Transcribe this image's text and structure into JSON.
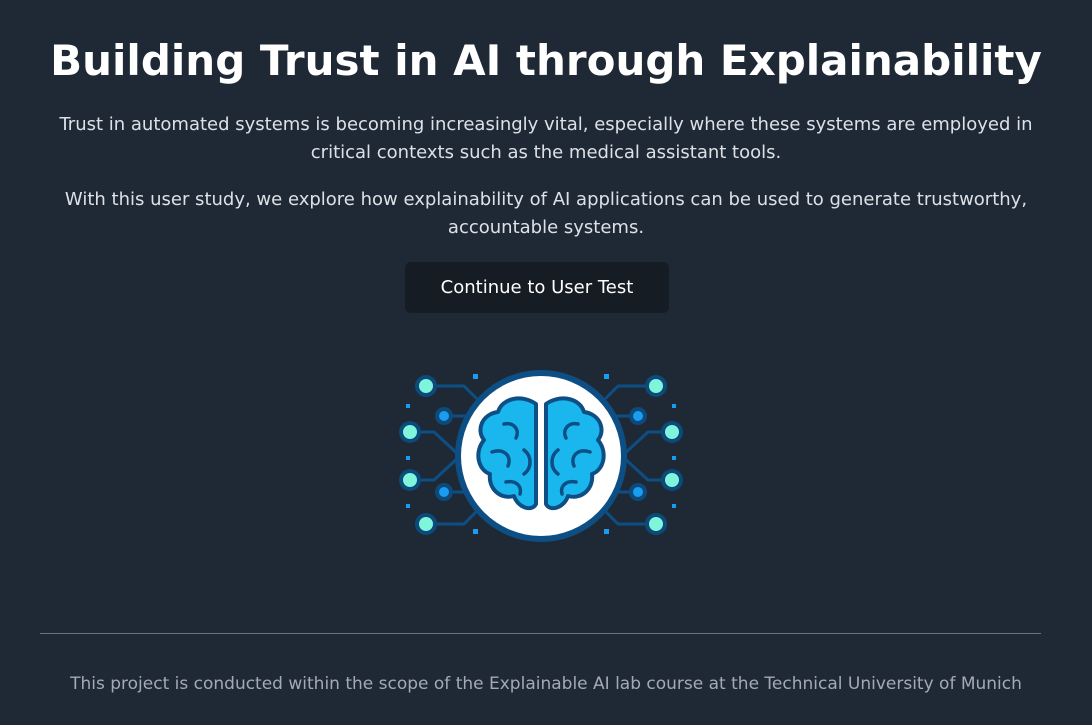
{
  "page": {
    "title": "Building Trust in AI through Explainability",
    "intro_paragraph": "Trust in automated systems is becoming increasingly vital, especially where these systems are employed in critical contexts such as the medical assistant tools.",
    "study_paragraph": "With this user study, we explore how explainability of AI applications can be used to generate trustworthy, accountable systems.",
    "cta_label": "Continue to User Test",
    "illustration_icon": "ai-brain-circuit-icon",
    "footer_text": "This project is conducted within the scope of the Explainable AI lab course at the Technical University of Munich"
  },
  "colors": {
    "background": "#1f2935",
    "button_background": "#151c24",
    "brain_fill": "#1ab6ee",
    "brain_outline": "#0d4f85",
    "node_teal": "#7ff5dc",
    "node_blue": "#1a9cf0",
    "node_ring": "#0c4a7a"
  }
}
